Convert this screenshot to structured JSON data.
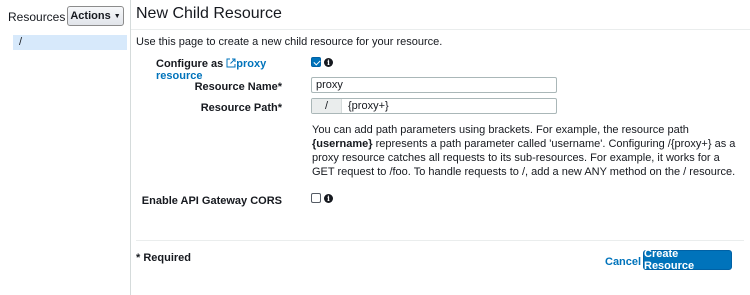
{
  "sidebar": {
    "title": "Resources",
    "actions_label": "Actions",
    "tree": [
      {
        "label": "/"
      }
    ]
  },
  "main": {
    "title": "New Child Resource",
    "intro": "Use this page to create a new child resource for your resource.",
    "configure_proxy": {
      "label_prefix": "Configure as",
      "link_text": "proxy resource",
      "checked": true
    },
    "resource_name": {
      "label": "Resource Name*",
      "value": "proxy"
    },
    "resource_path": {
      "label": "Resource Path*",
      "prefix": "/",
      "value": "{proxy+}"
    },
    "help_text": {
      "part1": "You can add path parameters using brackets. For example, the resource path ",
      "bold": "{username}",
      "part2": " represents a path parameter called 'username'. Configuring /{proxy+} as a proxy resource catches all requests to its sub-resources. For example, it works for a GET request to /foo. To handle requests to /, add a new ANY method on the / resource."
    },
    "cors": {
      "label": "Enable API Gateway CORS",
      "checked": false
    }
  },
  "footer": {
    "required_note": "* Required",
    "cancel_label": "Cancel",
    "create_label": "Create Resource"
  },
  "icons": {
    "external_link": "external-link-icon",
    "info": "info-icon",
    "caret": "caret-down-icon"
  },
  "colors": {
    "accent": "#0073bb",
    "selected_row": "#d7e9fb"
  }
}
